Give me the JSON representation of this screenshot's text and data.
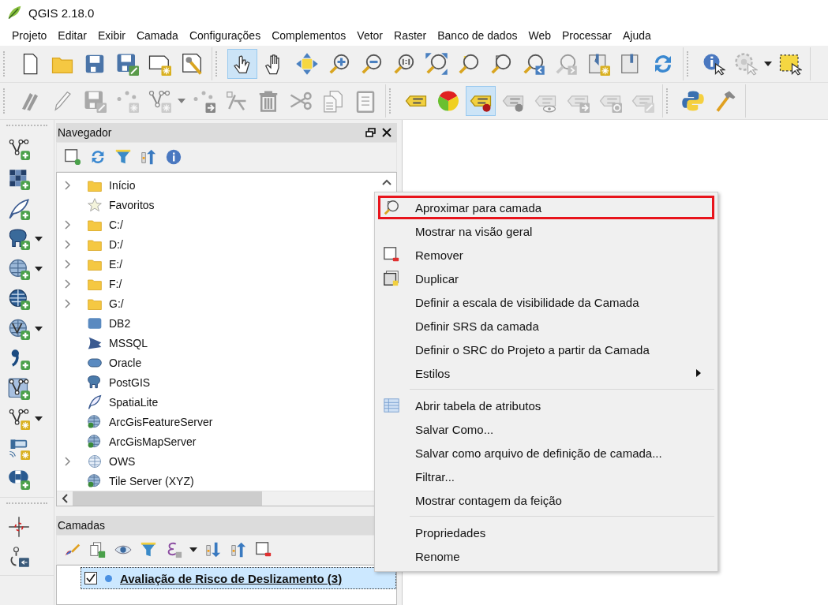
{
  "window": {
    "title": "QGIS 2.18.0"
  },
  "menu_bar": [
    "Projeto",
    "Editar",
    "Exibir",
    "Camada",
    "Configurações",
    "Complementos",
    "Vetor",
    "Raster",
    "Banco de dados",
    "Web",
    "Processar",
    "Ajuda"
  ],
  "toolbars": [
    {
      "groups": [
        [
          {
            "kind": "blank-page",
            "selected": false,
            "disabled": false
          },
          {
            "kind": "folder",
            "selected": false,
            "disabled": false
          },
          {
            "kind": "floppy-disk",
            "selected": false,
            "disabled": false
          },
          {
            "kind": "floppy-pencil",
            "selected": false,
            "disabled": false
          },
          {
            "kind": "page-star",
            "selected": false,
            "disabled": false
          },
          {
            "kind": "page-wrench",
            "selected": false,
            "disabled": false
          }
        ],
        [
          {
            "kind": "hand-pointer",
            "selected": true,
            "disabled": false
          },
          {
            "kind": "hand",
            "selected": false,
            "disabled": false
          },
          {
            "kind": "arrows-cross",
            "selected": false,
            "disabled": false
          },
          {
            "kind": "magnifier-plus",
            "selected": false,
            "disabled": false
          },
          {
            "kind": "magnifier-minus",
            "selected": false,
            "disabled": false
          },
          {
            "kind": "magnifier-one",
            "selected": false,
            "disabled": false
          },
          {
            "kind": "magnifier-arrows",
            "selected": false,
            "disabled": false
          },
          {
            "kind": "magnifier-selection",
            "selected": false,
            "disabled": false
          },
          {
            "kind": "magnifier-page",
            "selected": false,
            "disabled": false
          },
          {
            "kind": "magnifier-left",
            "selected": false,
            "disabled": false
          },
          {
            "kind": "magnifier-right",
            "selected": false,
            "disabled": true
          },
          {
            "kind": "map-star",
            "selected": false,
            "disabled": false
          },
          {
            "kind": "map-pin",
            "selected": false,
            "disabled": false
          },
          {
            "kind": "refresh",
            "selected": false,
            "disabled": false
          }
        ],
        [
          {
            "kind": "info-cursor",
            "selected": false,
            "disabled": false
          },
          {
            "kind": "gear-cursor",
            "selected": false,
            "disabled": true
          },
          {
            "kind": "caret",
            "selected": false,
            "disabled": false
          },
          {
            "kind": "select-box",
            "selected": false,
            "disabled": false
          }
        ]
      ]
    },
    {
      "groups": [
        [
          {
            "kind": "pencils",
            "selected": false,
            "disabled": true
          },
          {
            "kind": "pencil",
            "selected": false,
            "disabled": true
          },
          {
            "kind": "floppy-pencil",
            "selected": false,
            "disabled": true
          },
          {
            "kind": "dots-star",
            "selected": false,
            "disabled": true
          },
          {
            "kind": "vertex-star",
            "selected": false,
            "disabled": true
          },
          {
            "kind": "caret",
            "selected": false,
            "disabled": true
          },
          {
            "kind": "dots-arrow",
            "selected": false,
            "disabled": true
          },
          {
            "kind": "node-tool",
            "selected": false,
            "disabled": true
          },
          {
            "kind": "trash",
            "selected": false,
            "disabled": true
          },
          {
            "kind": "scissors",
            "selected": false,
            "disabled": true
          },
          {
            "kind": "copy-pages",
            "selected": false,
            "disabled": true
          },
          {
            "kind": "clipboard",
            "selected": false,
            "disabled": true
          }
        ],
        [
          {
            "kind": "label-tag",
            "selected": false,
            "disabled": false
          },
          {
            "kind": "pie-chart",
            "selected": false,
            "disabled": false
          },
          {
            "kind": "label-pin",
            "selected": true,
            "disabled": false
          },
          {
            "kind": "label-pin",
            "selected": false,
            "disabled": true
          },
          {
            "kind": "label-eye",
            "selected": false,
            "disabled": true
          },
          {
            "kind": "label-arrow",
            "selected": false,
            "disabled": true
          },
          {
            "kind": "label-rotate",
            "selected": false,
            "disabled": true
          },
          {
            "kind": "label-edit",
            "selected": false,
            "disabled": true
          }
        ],
        [
          {
            "kind": "python",
            "selected": false,
            "disabled": false
          },
          {
            "kind": "hammer",
            "selected": false,
            "disabled": false
          }
        ]
      ]
    }
  ],
  "side_toolbar": [
    [
      {
        "kind": "vertex-plus",
        "dropdown": false
      },
      {
        "kind": "raster-plus",
        "dropdown": false
      },
      {
        "kind": "feather-plus",
        "dropdown": false
      },
      {
        "kind": "elephant-plus",
        "dropdown": true
      },
      {
        "kind": "globe-plus",
        "dropdown": true
      },
      {
        "kind": "globe-filled-plus",
        "dropdown": false
      },
      {
        "kind": "globe-vertex-plus",
        "dropdown": true
      },
      {
        "kind": "comma-plus",
        "dropdown": false
      },
      {
        "kind": "vertex-frame-plus",
        "dropdown": false
      },
      {
        "kind": "vertex-star",
        "dropdown": true
      },
      {
        "kind": "pipes-star",
        "dropdown": false
      },
      {
        "kind": "pill-plus",
        "dropdown": false
      }
    ],
    [
      {
        "kind": "crosshair",
        "dropdown": false
      },
      {
        "kind": "gps-plug",
        "dropdown": false
      }
    ]
  ],
  "browser_panel": {
    "title": "Navegador",
    "toolbar": [
      {
        "kind": "square-plus"
      },
      {
        "kind": "refresh"
      },
      {
        "kind": "funnel"
      },
      {
        "kind": "collapse-arrow"
      },
      {
        "kind": "info-circle"
      }
    ],
    "items": [
      {
        "label": "Início",
        "kind": "folder",
        "expandable": true
      },
      {
        "label": "Favoritos",
        "kind": "star",
        "expandable": false
      },
      {
        "label": "C:/",
        "kind": "folder",
        "expandable": true
      },
      {
        "label": "D:/",
        "kind": "folder",
        "expandable": true
      },
      {
        "label": "E:/",
        "kind": "folder",
        "expandable": true
      },
      {
        "label": "F:/",
        "kind": "folder",
        "expandable": true
      },
      {
        "label": "G:/",
        "kind": "folder",
        "expandable": true
      },
      {
        "label": "DB2",
        "kind": "db2",
        "expandable": false
      },
      {
        "label": "MSSQL",
        "kind": "fan",
        "expandable": false
      },
      {
        "label": "Oracle",
        "kind": "pill",
        "expandable": false
      },
      {
        "label": "PostGIS",
        "kind": "elephant",
        "expandable": false
      },
      {
        "label": "SpatiaLite",
        "kind": "feather",
        "expandable": false
      },
      {
        "label": "ArcGisFeatureServer",
        "kind": "globe",
        "expandable": false
      },
      {
        "label": "ArcGisMapServer",
        "kind": "globe",
        "expandable": false
      },
      {
        "label": "OWS",
        "kind": "globe-grid",
        "expandable": true
      },
      {
        "label": "Tile Server (XYZ)",
        "kind": "globe",
        "expandable": false
      }
    ]
  },
  "layers_panel": {
    "title": "Camadas",
    "toolbar": [
      {
        "kind": "brush"
      },
      {
        "kind": "copy-plus"
      },
      {
        "kind": "eye"
      },
      {
        "kind": "funnel"
      },
      {
        "kind": "epsilon"
      },
      {
        "kind": "caret"
      },
      {
        "kind": "expand-arrows"
      },
      {
        "kind": "collapse-arrow"
      },
      {
        "kind": "square-minus"
      }
    ],
    "layers": [
      {
        "name": "Avaliação de Risco de Deslizamento (3)",
        "checked": true,
        "selected": true
      }
    ]
  },
  "context_menu": [
    {
      "kind": "item",
      "label": "Aproximar para camada",
      "outlined": true,
      "submenu": false
    },
    {
      "kind": "item",
      "label": "Mostrar na visão geral",
      "outlined": false,
      "submenu": false
    },
    {
      "kind": "item",
      "label": "Remover",
      "outlined": false,
      "submenu": false
    },
    {
      "kind": "item",
      "label": "Duplicar",
      "outlined": false,
      "submenu": false
    },
    {
      "kind": "item",
      "label": "Definir a escala de visibilidade da Camada",
      "outlined": false,
      "submenu": false
    },
    {
      "kind": "item",
      "label": "Definir SRS da camada",
      "outlined": false,
      "submenu": false
    },
    {
      "kind": "item",
      "label": "Definir o SRC do Projeto a partir da Camada",
      "outlined": false,
      "submenu": false
    },
    {
      "kind": "item",
      "label": "Estilos",
      "outlined": false,
      "submenu": true
    },
    {
      "kind": "separator"
    },
    {
      "kind": "item",
      "label": "Abrir tabela de atributos",
      "outlined": false,
      "submenu": false
    },
    {
      "kind": "item",
      "label": "Salvar Como...",
      "outlined": false,
      "submenu": false
    },
    {
      "kind": "item",
      "label": "Salvar como arquivo de definição de camada...",
      "outlined": false,
      "submenu": false
    },
    {
      "kind": "item",
      "label": "Filtrar...",
      "outlined": false,
      "submenu": false
    },
    {
      "kind": "item",
      "label": "Mostrar contagem da feição",
      "outlined": false,
      "submenu": false
    },
    {
      "kind": "separator"
    },
    {
      "kind": "item",
      "label": "Propriedades",
      "outlined": false,
      "submenu": false
    },
    {
      "kind": "item",
      "label": "Renome",
      "outlined": false,
      "submenu": false
    }
  ]
}
